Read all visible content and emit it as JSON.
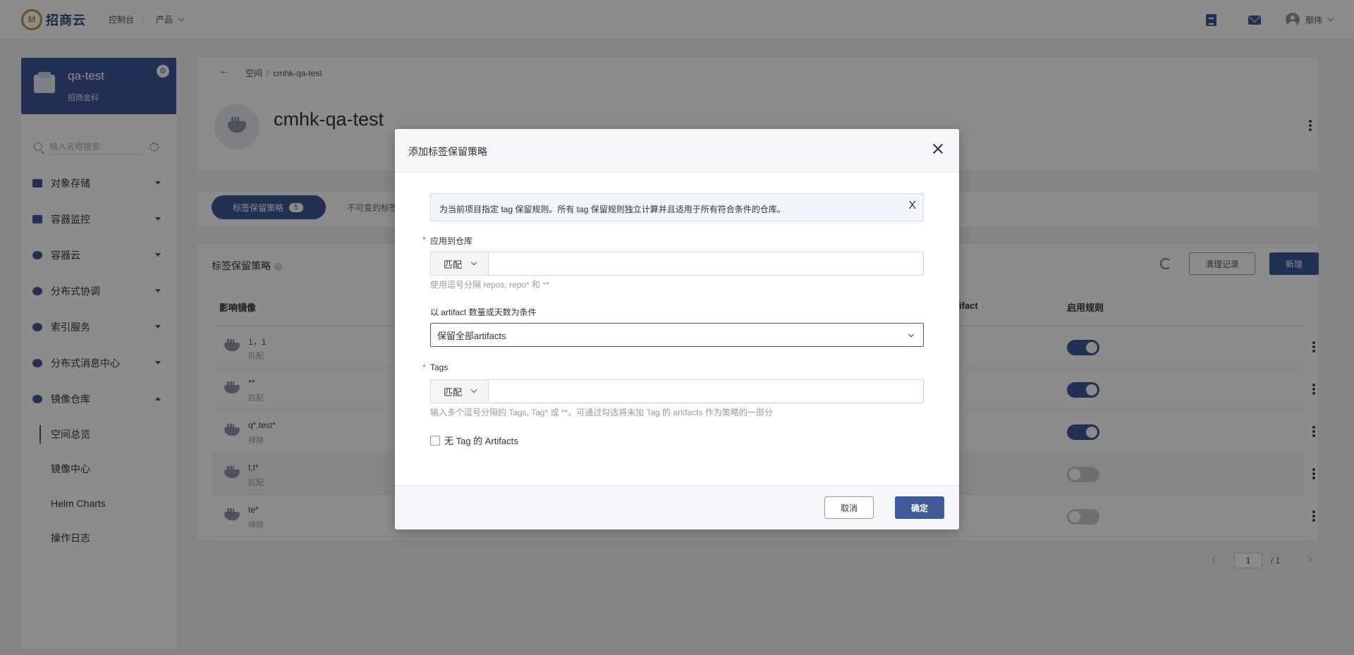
{
  "topbar": {
    "brand": "招商云",
    "console": "控制台",
    "product": "产品",
    "user": "鄢伟"
  },
  "sidebar": {
    "project_name": "qa-test",
    "project_org": "招商金科",
    "search_placeholder": "输入名称搜索",
    "menu": [
      {
        "label": "对象存储",
        "icon": "grid-icon"
      },
      {
        "label": "容器监控",
        "icon": "monitor-icon"
      },
      {
        "label": "容器云",
        "icon": "cube-icon"
      },
      {
        "label": "分布式协调",
        "icon": "bird-icon"
      },
      {
        "label": "索引服务",
        "icon": "nodes-icon"
      },
      {
        "label": "分布式消息中心",
        "icon": "rocket-icon"
      },
      {
        "label": "镜像仓库",
        "icon": "ship-icon"
      }
    ],
    "sub_menu": [
      "空间总览",
      "镜像中心",
      "Helm Charts",
      "操作日志"
    ]
  },
  "header": {
    "breadcrumb_root": "空间",
    "breadcrumb_current": "cmhk-qa-test",
    "title": "cmhk-qa-test"
  },
  "tabs": {
    "active_label": "标签保留策略",
    "active_count": "5",
    "second_label": "不可变的标签"
  },
  "table": {
    "title": "标签保留策略",
    "clear_log": "清理记录",
    "add": "新增",
    "columns": {
      "image": "影响镜像",
      "artifact": "ifact",
      "enable": "启用规则"
    },
    "rows": [
      {
        "tag": "1，1",
        "kind": "匹配",
        "enabled": true
      },
      {
        "tag": "**",
        "kind": "匹配",
        "enabled": true
      },
      {
        "tag": "q*,test*",
        "kind": "排除",
        "enabled": true
      },
      {
        "tag": "t,t*",
        "kind": "匹配",
        "enabled": false
      },
      {
        "tag": "te*",
        "kind": "排除",
        "enabled": false
      }
    ]
  },
  "pager": {
    "page": "1",
    "total": "/ 1"
  },
  "modal": {
    "title": "添加标签保留策略",
    "info": "为当前项目指定 tag 保留规则。所有 tag 保留规则独立计算并且适用于所有符合条件的仓库。",
    "info_close": "X",
    "repo_label": "应用到仓库",
    "repo_match": "匹配",
    "repo_value": "",
    "repo_hint": "使用逗号分隔 repos, repo* 和 **",
    "cond_label": "以 artifact 数量或天数为条件",
    "cond_value": "保留全部artifacts",
    "tags_label": "Tags",
    "tags_match": "匹配",
    "tags_value": "",
    "tags_hint": "输入多个逗号分隔的 Tags, Tag* 或 **。可通过勾选将未加 Tag 的 artifacts 作为策略的一部分",
    "untagged_label": "无 Tag 的 Artifacts",
    "untagged_checked": false,
    "cancel": "取消",
    "confirm": "确定"
  },
  "colors": {
    "primary": "#3d5a9a",
    "overlay": "rgba(0,0,0,0.45)",
    "required": "#e04c3c"
  }
}
